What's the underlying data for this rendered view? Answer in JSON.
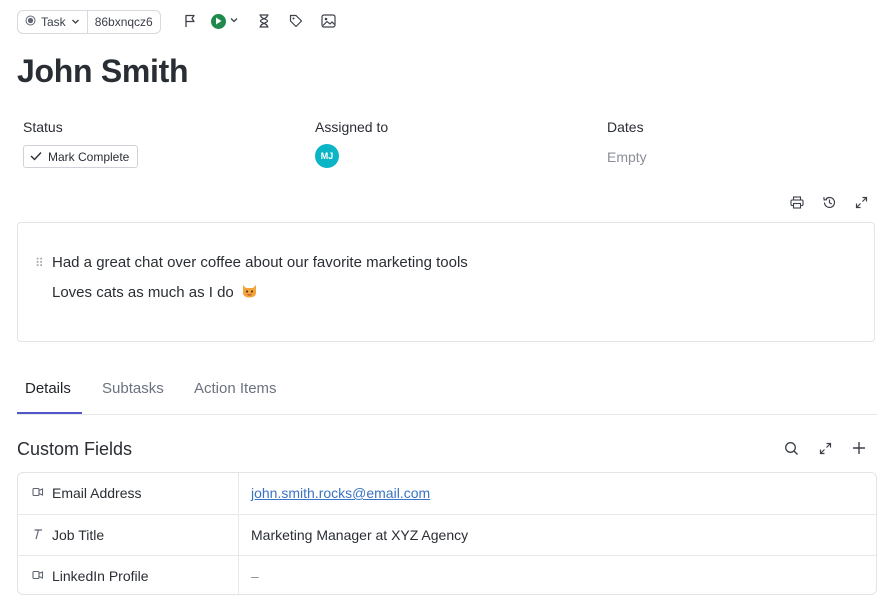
{
  "toolbar": {
    "task_type": "Task",
    "task_id": "86bxnqcz6",
    "icons": [
      "flag-icon",
      "play-icon",
      "chevron-down-icon",
      "hourglass-icon",
      "tag-icon",
      "image-icon"
    ]
  },
  "task": {
    "title": "John Smith"
  },
  "fields": {
    "status_label": "Status",
    "status_button": "Mark Complete",
    "assigned_label": "Assigned to",
    "assignee_initials": "MJ",
    "assignee_color": "#0cb5c6",
    "dates_label": "Dates",
    "dates_value": "Empty"
  },
  "description": {
    "line1": "Had a great chat over coffee about our favorite marketing tools",
    "line2": "Loves cats as much as I do",
    "line2_emoji": "cat-face-icon"
  },
  "tabs": [
    {
      "label": "Details",
      "active": true
    },
    {
      "label": "Subtasks",
      "active": false
    },
    {
      "label": "Action Items",
      "active": false
    }
  ],
  "custom_fields": {
    "title": "Custom Fields",
    "rows": [
      {
        "icon": "email-icon",
        "name": "Email Address",
        "value": "john.smith.rocks@email.com"
      },
      {
        "icon": "text-icon",
        "name": "Job Title",
        "value": "Marketing Manager at XYZ Agency"
      },
      {
        "icon": "link-icon",
        "name": "LinkedIn Profile",
        "value": "–"
      }
    ]
  },
  "colors": {
    "accent": "#4f57c9",
    "play": "#1f8a4c",
    "link": "#3b73c4"
  }
}
